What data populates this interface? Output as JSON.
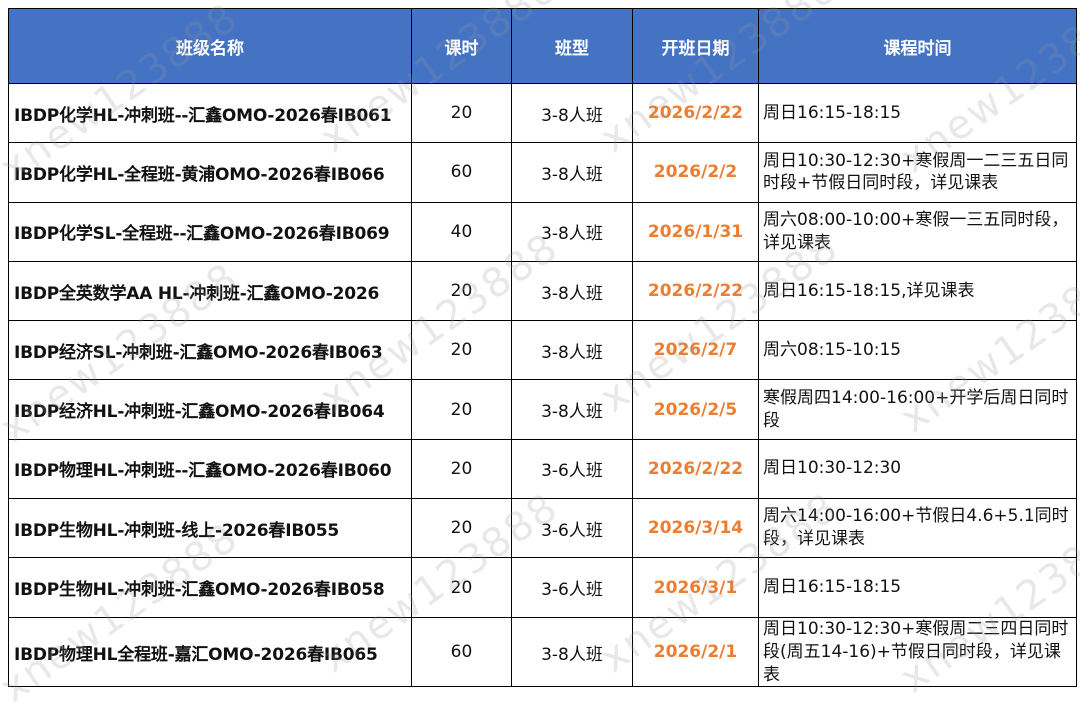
{
  "table": {
    "headers": [
      "班级名称",
      "课时",
      "班型",
      "开班日期",
      "课程时间"
    ],
    "rows": [
      {
        "name": "IBDP化学HL-冲刺班--汇鑫OMO-2026春IB061",
        "hours": "20",
        "type": "3-8人班",
        "date": "2026/2/22",
        "time": "周日16:15-18:15"
      },
      {
        "name": "IBDP化学HL-全程班-黄浦OMO-2026春IB066",
        "hours": "60",
        "type": "3-8人班",
        "date": "2026/2/2",
        "time": "周日10:30-12:30+寒假周一二三五日同时段+节假日同时段，详见课表"
      },
      {
        "name": "IBDP化学SL-全程班--汇鑫OMO-2026春IB069",
        "hours": "40",
        "type": "3-8人班",
        "date": "2026/1/31",
        "time": "周六08:00-10:00+寒假一三五同时段，详见课表"
      },
      {
        "name": "IBDP全英数学AA HL-冲刺班-汇鑫OMO-2026",
        "hours": "20",
        "type": "3-8人班",
        "date": "2026/2/22",
        "time": "周日16:15-18:15,详见课表"
      },
      {
        "name": "IBDP经济SL-冲刺班-汇鑫OMO-2026春IB063",
        "hours": "20",
        "type": "3-8人班",
        "date": "2026/2/7",
        "time": "周六08:15-10:15"
      },
      {
        "name": "IBDP经济HL-冲刺班-汇鑫OMO-2026春IB064",
        "hours": "20",
        "type": "3-8人班",
        "date": "2026/2/5",
        "time": "寒假周四14:00-16:00+开学后周日同时段"
      },
      {
        "name": "IBDP物理HL-冲刺班--汇鑫OMO-2026春IB060",
        "hours": "20",
        "type": "3-6人班",
        "date": "2026/2/22",
        "time": "周日10:30-12:30"
      },
      {
        "name": "IBDP生物HL-冲刺班-线上-2026春IB055",
        "hours": "20",
        "type": "3-6人班",
        "date": "2026/3/14",
        "time": "周六14:00-16:00+节假日4.6+5.1同时段，详见课表"
      },
      {
        "name": "IBDP生物HL-冲刺班-汇鑫OMO-2026春IB058",
        "hours": "20",
        "type": "3-6人班",
        "date": "2026/3/1",
        "time": "周日16:15-18:15"
      },
      {
        "name": "IBDP物理HL全程班-嘉汇OMO-2026春IB065",
        "hours": "60",
        "type": "3-8人班",
        "date": "2026/2/1",
        "time": "周日10:30-12:30+寒假周二三四日同时段(周五14-16)+节假日同时段，详见课表"
      }
    ]
  },
  "watermark_text": "xnew123888",
  "colors": {
    "header_bg": "#4473c4",
    "header_text": "#ffffff",
    "date_text": "#ed7d31",
    "border": "#000000"
  }
}
